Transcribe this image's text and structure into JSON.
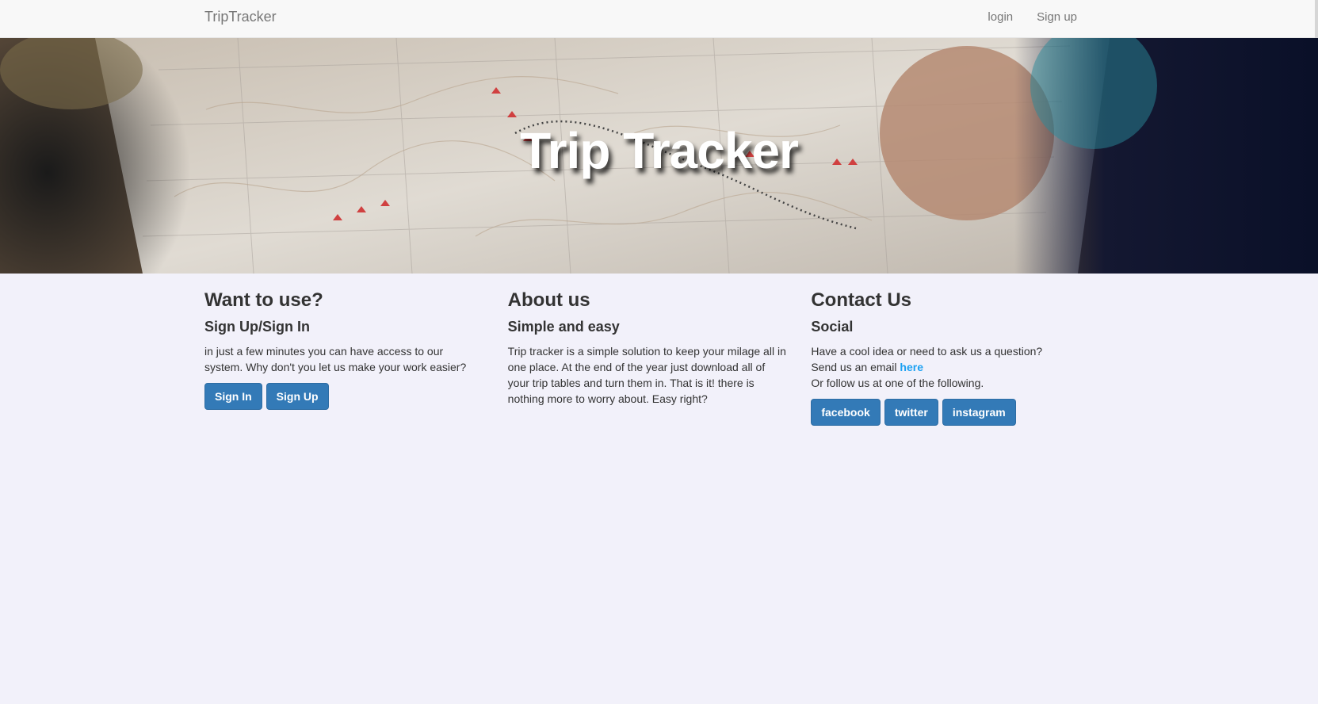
{
  "navbar": {
    "brand": "TripTracker",
    "links": [
      "login",
      "Sign up"
    ]
  },
  "hero": {
    "title": "Trip Tracker"
  },
  "columns": {
    "want": {
      "heading": "Want to use?",
      "subheading": "Sign Up/Sign In",
      "text": "in just a few minutes you can have access to our system. Why don't you let us make your work easier?",
      "buttons": [
        "Sign In",
        "Sign Up"
      ]
    },
    "about": {
      "heading": "About us",
      "subheading": "Simple and easy",
      "text": "Trip tracker is a simple solution to keep your milage all in one place. At the end of the year just download all of your trip tables and turn them in. That is it! there is nothing more to worry about. Easy right?"
    },
    "contact": {
      "heading": "Contact Us",
      "subheading": "Social",
      "line1": "Have a cool idea or need to ask us a question?",
      "line2_prefix": "Send us an email ",
      "line2_link": "here",
      "line3": "Or follow us at one of the following.",
      "buttons": [
        "facebook",
        "twitter",
        "instagram"
      ]
    }
  },
  "colors": {
    "page_background": "#f2f1fa",
    "button_primary": "#337ab7",
    "link_accent": "#1da1f2",
    "navbar_background": "#f8f8f8"
  }
}
